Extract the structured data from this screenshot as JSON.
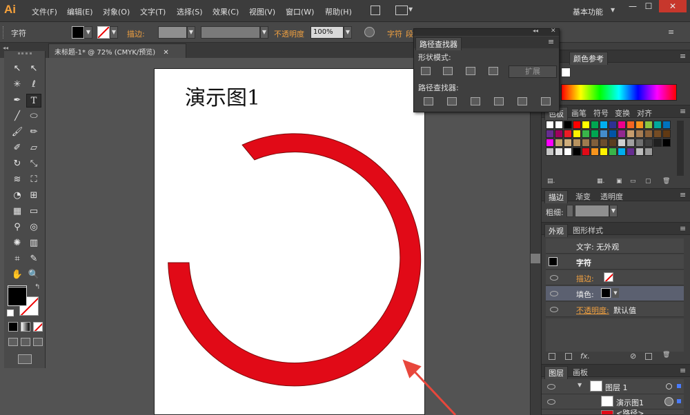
{
  "app": {
    "logo": "Ai",
    "workspace": "基本功能"
  },
  "menu": [
    "文件(F)",
    "编辑(E)",
    "对象(O)",
    "文字(T)",
    "选择(S)",
    "效果(C)",
    "视图(V)",
    "窗口(W)",
    "帮助(H)"
  ],
  "window_controls": {
    "minimize": "—",
    "maximize": "☐",
    "close": "✕"
  },
  "control_bar": {
    "object_type": "字符",
    "stroke_label": "描边:",
    "opacity_label": "不透明度",
    "opacity_value": "100%",
    "char_label": "字符",
    "para_label": "段"
  },
  "document_tab": {
    "title": "未标题-1* @ 72% (CMYK/预览)",
    "close": "✕"
  },
  "artboard": {
    "title_text": "演示图1"
  },
  "pathfinder": {
    "title": "路径查找器",
    "shape_modes_label": "形状模式:",
    "expand_label": "扩展",
    "pathfinders_label": "路径查找器:"
  },
  "swatches_panel": {
    "tabs": [
      "色板",
      "画笔",
      "符号",
      "变换",
      "对齐"
    ],
    "color_guide_tab": "颜色参考"
  },
  "stroke_panel": {
    "tabs": [
      "描边",
      "渐变",
      "透明度"
    ],
    "weight_label": "粗细:"
  },
  "appearance_panel": {
    "tabs": [
      "外观",
      "图形样式"
    ],
    "header_text": "文字: 无外观",
    "char_label": "字符",
    "stroke_label": "描边:",
    "fill_label": "填色:",
    "opacity_label": "不透明度:",
    "opacity_value": "默认值",
    "fx_label": "fx."
  },
  "layers_panel": {
    "tabs": [
      "图层",
      "画板"
    ],
    "layer_name": "图层 1",
    "item1": "演示图1",
    "item2": "<路径>"
  },
  "colors": {
    "ring": "#e10a17",
    "arrow": "#e8473c",
    "accent": "#f0a040"
  }
}
